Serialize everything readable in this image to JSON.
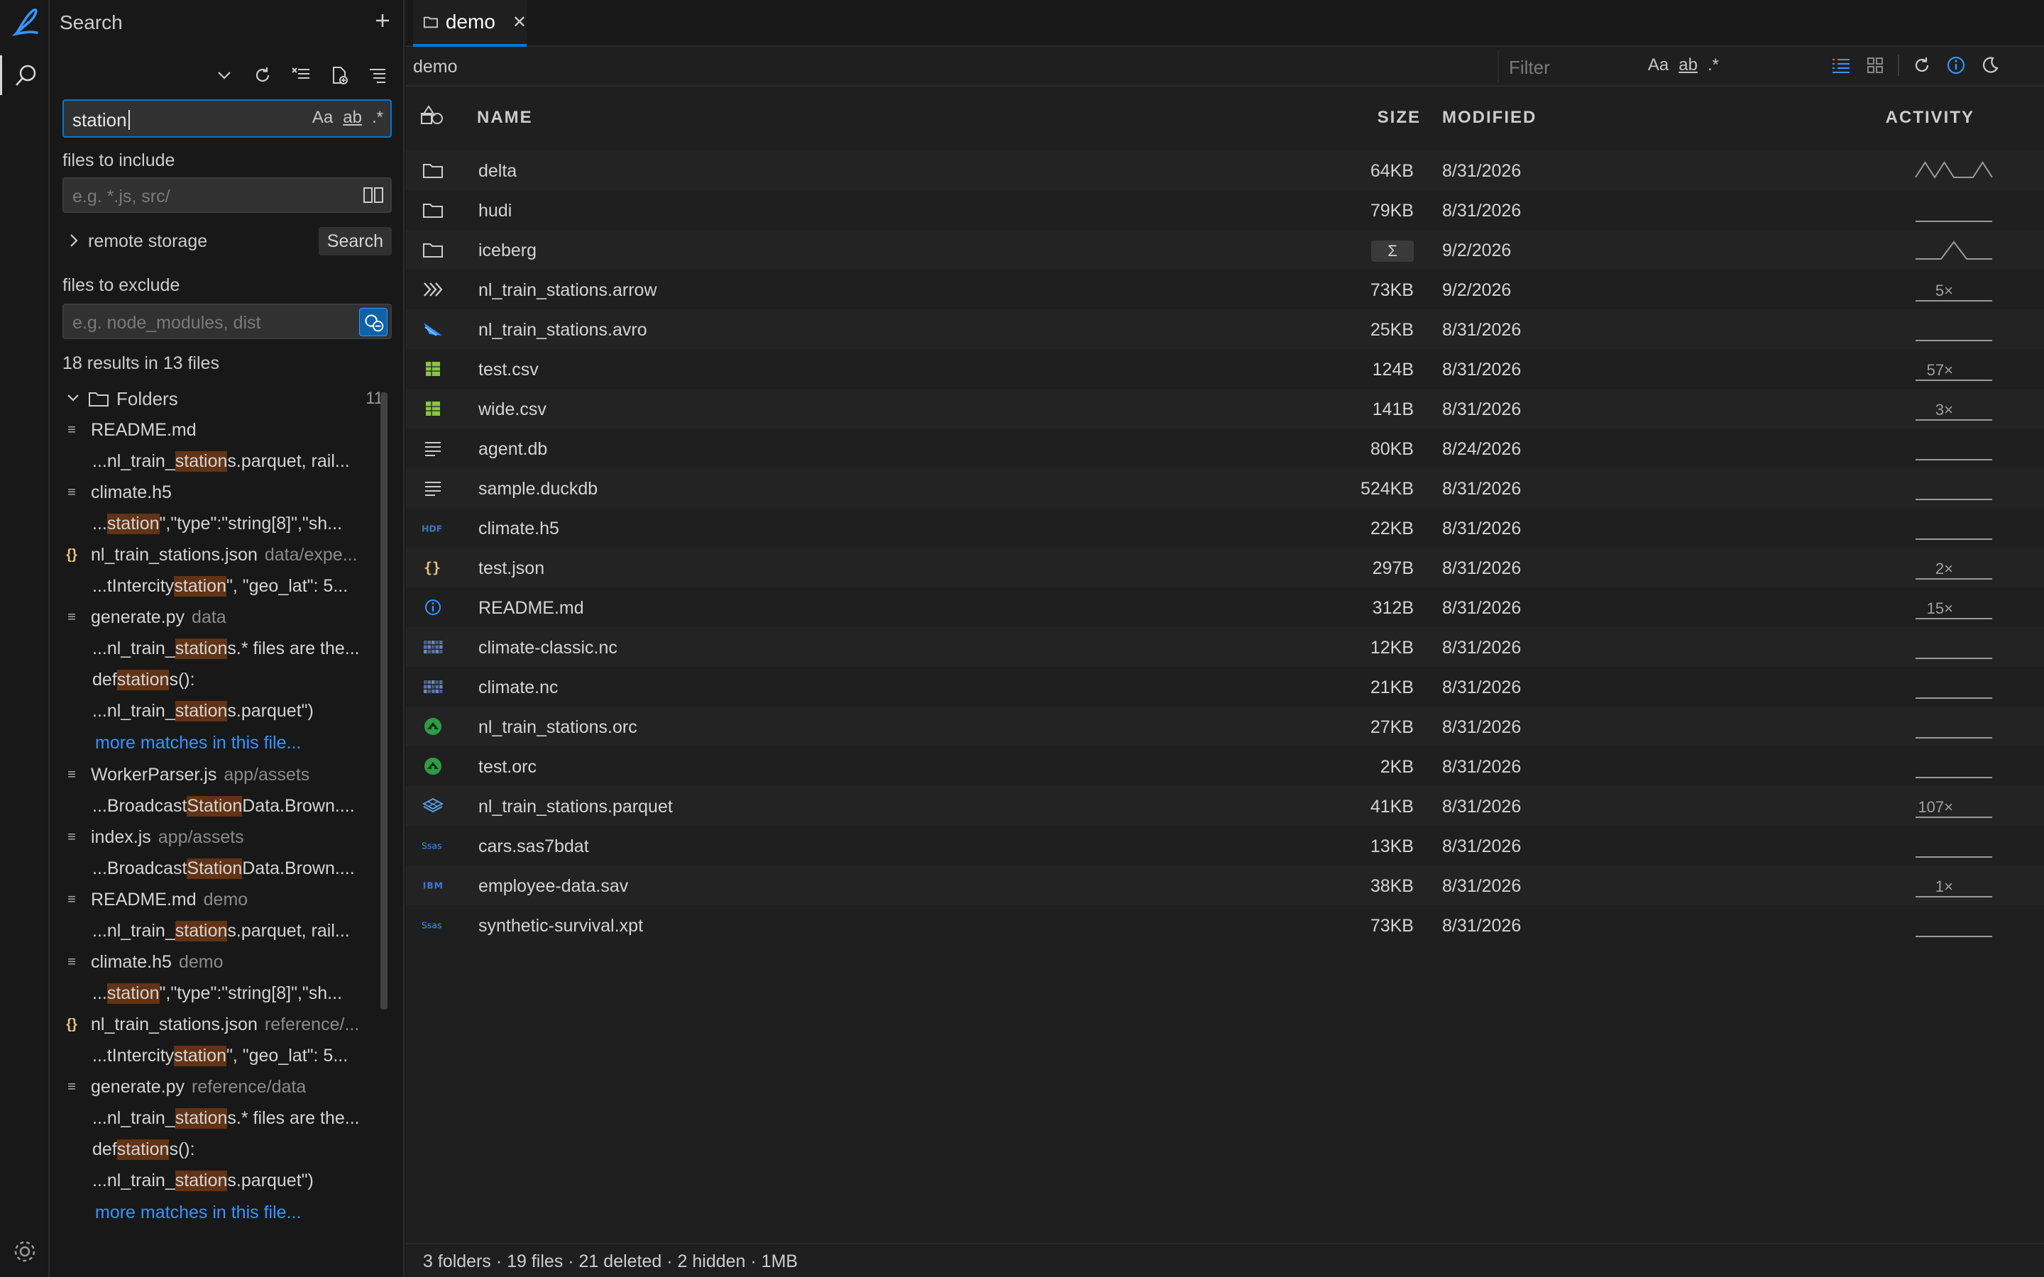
{
  "activity_bar": {
    "logo_icon": "app-logo-icon",
    "search_icon": "search-icon",
    "settings_icon": "gear-icon"
  },
  "sidebar": {
    "title": "Search",
    "search": {
      "value": "station",
      "opt_case": "Aa",
      "opt_word": "ab",
      "opt_regex": ".*"
    },
    "include": {
      "label": "files to include",
      "placeholder": "e.g. *.js, src/"
    },
    "remote": {
      "label": "remote storage",
      "button": "Search"
    },
    "exclude": {
      "label": "files to exclude",
      "placeholder": "e.g. node_modules, dist"
    },
    "summary": "18 results in 13 files",
    "group": {
      "label": "Folders",
      "count": "11"
    },
    "results": [
      {
        "name": "README.md",
        "dir": "",
        "icon": "≡",
        "matches": [
          [
            "...nl_train_",
            "station",
            "s.parquet, rail..."
          ]
        ]
      },
      {
        "name": "climate.h5",
        "dir": "",
        "icon": "≡",
        "matches": [
          [
            "...",
            "station",
            "\",\"type\":\"string[8]\",\"sh..."
          ]
        ]
      },
      {
        "name": "nl_train_stations.json",
        "dir": "data/expe...",
        "icon": "{}",
        "matches": [
          [
            "...tIntercity",
            "station",
            "\", \"geo_lat\": 5..."
          ]
        ]
      },
      {
        "name": "generate.py",
        "dir": "data",
        "icon": "≡",
        "matches": [
          [
            "...nl_train_",
            "station",
            "s.* files are the..."
          ],
          [
            "def ",
            "station",
            "s():"
          ],
          [
            "...nl_train_",
            "station",
            "s.parquet\")"
          ]
        ],
        "more": "more matches in this file..."
      },
      {
        "name": "WorkerParser.js",
        "dir": "app/assets",
        "icon": "≡",
        "matches": [
          [
            "...Broadcast",
            "Station",
            "Data.Brown...."
          ]
        ]
      },
      {
        "name": "index.js",
        "dir": "app/assets",
        "icon": "≡",
        "matches": [
          [
            "...Broadcast",
            "Station",
            "Data.Brown...."
          ]
        ]
      },
      {
        "name": "README.md",
        "dir": "demo",
        "icon": "≡",
        "matches": [
          [
            "...nl_train_",
            "station",
            "s.parquet, rail..."
          ]
        ]
      },
      {
        "name": "climate.h5",
        "dir": "demo",
        "icon": "≡",
        "matches": [
          [
            "...",
            "station",
            "\",\"type\":\"string[8]\",\"sh..."
          ]
        ]
      },
      {
        "name": "nl_train_stations.json",
        "dir": "reference/...",
        "icon": "{}",
        "matches": [
          [
            "...tIntercity",
            "station",
            "\", \"geo_lat\": 5..."
          ]
        ]
      },
      {
        "name": "generate.py",
        "dir": "reference/data",
        "icon": "≡",
        "matches": [
          [
            "...nl_train_",
            "station",
            "s.* files are the..."
          ],
          [
            "def ",
            "station",
            "s():"
          ],
          [
            "...nl_train_",
            "station",
            "s.parquet\")"
          ]
        ],
        "more": "more matches in this file..."
      }
    ]
  },
  "editor": {
    "tab": {
      "label": "demo"
    },
    "breadcrumb": "demo",
    "filter": {
      "placeholder": "Filter",
      "opt_case": "Aa",
      "opt_word": "ab",
      "opt_regex": ".*"
    },
    "columns": {
      "name": "NAME",
      "size": "SIZE",
      "modified": "MODIFIED",
      "activity": "ACTIVITY"
    },
    "rows": [
      {
        "name": "delta",
        "icon": "folder-icon",
        "size": "64KB",
        "modified": "8/31/2026",
        "count": "",
        "spark": [
          0.2,
          0.9,
          0.2,
          0.9,
          0.2,
          0.2,
          0.2,
          0.9,
          0.2
        ]
      },
      {
        "name": "hudi",
        "icon": "folder-icon",
        "size": "79KB",
        "modified": "8/31/2026",
        "count": "",
        "spark": []
      },
      {
        "name": "iceberg",
        "icon": "folder-icon",
        "size": "Σ",
        "modified": "9/2/2026",
        "count": "",
        "spark": [
          0.1,
          0.1,
          0.1,
          0.9,
          0.1,
          0.1,
          0.1
        ]
      },
      {
        "name": "nl_train_stations.arrow",
        "icon": "arrow-icon",
        "size": "73KB",
        "modified": "9/2/2026",
        "count": "5×",
        "spark": []
      },
      {
        "name": "nl_train_stations.avro",
        "icon": "avro-icon",
        "size": "25KB",
        "modified": "8/31/2026",
        "count": "",
        "spark": []
      },
      {
        "name": "test.csv",
        "icon": "csv-icon",
        "size": "124B",
        "modified": "8/31/2026",
        "count": "57×",
        "spark": []
      },
      {
        "name": "wide.csv",
        "icon": "csv-icon",
        "size": "141B",
        "modified": "8/31/2026",
        "count": "3×",
        "spark": []
      },
      {
        "name": "agent.db",
        "icon": "file-lines-icon",
        "size": "80KB",
        "modified": "8/24/2026",
        "count": "",
        "spark": []
      },
      {
        "name": "sample.duckdb",
        "icon": "file-lines-icon",
        "size": "524KB",
        "modified": "8/31/2026",
        "count": "",
        "spark": []
      },
      {
        "name": "climate.h5",
        "icon": "hdf-icon",
        "size": "22KB",
        "modified": "8/31/2026",
        "count": "",
        "spark": []
      },
      {
        "name": "test.json",
        "icon": "json-icon",
        "size": "297B",
        "modified": "8/31/2026",
        "count": "2×",
        "spark": []
      },
      {
        "name": "README.md",
        "icon": "info-icon",
        "size": "312B",
        "modified": "8/31/2026",
        "count": "15×",
        "spark": []
      },
      {
        "name": "climate-classic.nc",
        "icon": "netcdf-icon",
        "size": "12KB",
        "modified": "8/31/2026",
        "count": "",
        "spark": []
      },
      {
        "name": "climate.nc",
        "icon": "netcdf-icon",
        "size": "21KB",
        "modified": "8/31/2026",
        "count": "",
        "spark": []
      },
      {
        "name": "nl_train_stations.orc",
        "icon": "orc-icon",
        "size": "27KB",
        "modified": "8/31/2026",
        "count": "",
        "spark": []
      },
      {
        "name": "test.orc",
        "icon": "orc-icon",
        "size": "2KB",
        "modified": "8/31/2026",
        "count": "",
        "spark": []
      },
      {
        "name": "nl_train_stations.parquet",
        "icon": "parquet-icon",
        "size": "41KB",
        "modified": "8/31/2026",
        "count": "107×",
        "spark": []
      },
      {
        "name": "cars.sas7bdat",
        "icon": "sas-icon",
        "size": "13KB",
        "modified": "8/31/2026",
        "count": "",
        "spark": []
      },
      {
        "name": "employee-data.sav",
        "icon": "ibm-icon",
        "size": "38KB",
        "modified": "8/31/2026",
        "count": "1×",
        "spark": []
      },
      {
        "name": "synthetic-survival.xpt",
        "icon": "sas-icon",
        "size": "73KB",
        "modified": "8/31/2026",
        "count": "",
        "spark": []
      }
    ],
    "status": "3 folders · 19 files · 21 deleted · 2 hidden · 1MB"
  },
  "icon_labels": {
    "sas": "Ssas",
    "ibm": "IBM",
    "hdf": "HDF"
  },
  "colors": {
    "accent": "#0078d4",
    "link": "#3794ff",
    "match_highlight": "#623315",
    "csv": "#8bc34a",
    "orc": "#2e9c47",
    "parquet": "#50a0e6"
  }
}
